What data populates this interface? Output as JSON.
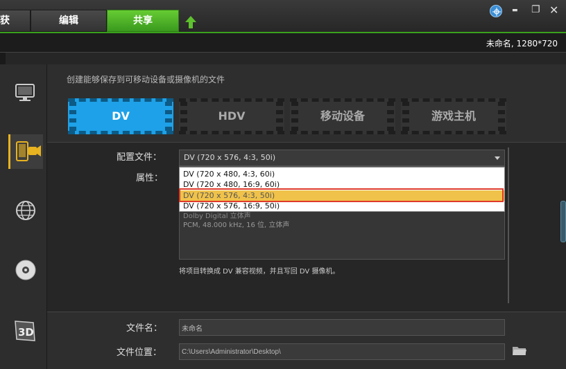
{
  "tabs": {
    "capture": "获",
    "edit": "编辑",
    "share": "共享"
  },
  "project": {
    "name": "未命名, 1280*720"
  },
  "window_controls": {
    "minimize": "▬",
    "maximize": "❐",
    "close": "✕"
  },
  "main": {
    "description": "创建能够保存到可移动设备或摄像机的文件",
    "format_tabs": [
      "DV",
      "HDV",
      "移动设备",
      "游戏主机"
    ]
  },
  "settings": {
    "profile_label": "配置文件：",
    "profile_value": "DV (720 x 576, 4:3, 50i)",
    "properties_label": "属性：",
    "properties_line1": "Dolby Digital 立体声",
    "properties_line2": "PCM, 48.000 kHz, 16 位, 立体声",
    "dropdown_options": [
      "DV (720 x 480, 4:3, 60i)",
      "DV (720 x 480, 16:9, 60i)",
      "DV (720 x 576, 4:3, 50i)",
      "DV (720 x 576, 16:9, 50i)"
    ],
    "note": "将项目转换成 DV 兼容视频，并且写回 DV 摄像机。"
  },
  "output": {
    "filename_label": "文件名：",
    "filename_value": "未命名",
    "location_label": "文件位置：",
    "location_value": "C:\\Users\\Administrator\\Desktop\\"
  },
  "colors": {
    "accent_green": "#4cb52a",
    "accent_blue": "#1ea1e8",
    "selection_yellow": "#f0c24a",
    "highlight_red": "#e03a2a"
  },
  "icons": [
    "upload-icon",
    "globe-icon",
    "monitor-icon",
    "mobile-device-icon",
    "web-globe-icon",
    "dvd-disc-icon",
    "3d-icon",
    "folder-icon"
  ]
}
